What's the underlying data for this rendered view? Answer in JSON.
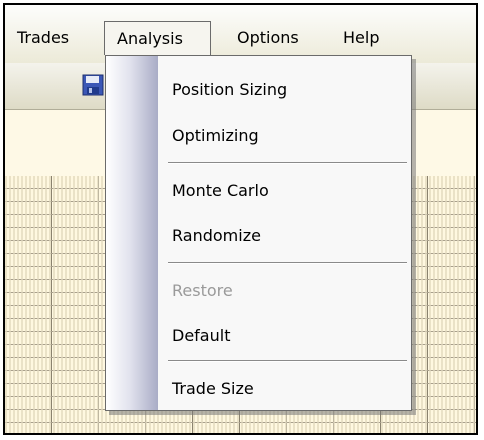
{
  "menubar": {
    "items": [
      {
        "label": "Trades"
      },
      {
        "label": "Analysis",
        "active": true
      },
      {
        "label": "Options"
      },
      {
        "label": "Help"
      }
    ]
  },
  "toolbar": {
    "buttons": [
      {
        "icon": "save-icon"
      },
      {
        "icon": "print-icon"
      }
    ]
  },
  "dropdown": {
    "items": [
      {
        "label": "Position Sizing",
        "enabled": true
      },
      {
        "label": "Optimizing",
        "enabled": true
      },
      {
        "separator": true
      },
      {
        "label": "Monte Carlo",
        "enabled": true
      },
      {
        "label": "Randomize",
        "enabled": true
      },
      {
        "separator": true
      },
      {
        "label": "Restore",
        "enabled": false
      },
      {
        "label": "Default",
        "enabled": true
      },
      {
        "separator": true
      },
      {
        "label": "Trade Size",
        "enabled": true
      }
    ]
  },
  "colors": {
    "menu_border": "#6b6b6b",
    "disabled_text": "#9a9a9a",
    "content_bg": "#fef9e6",
    "gutter_dark": "#a9acc6"
  }
}
